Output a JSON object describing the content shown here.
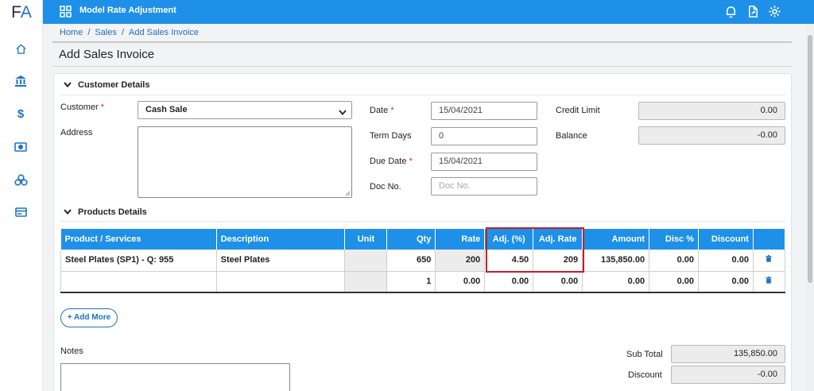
{
  "sidebar": {
    "logo_f": "F",
    "logo_a": "A",
    "items": [
      {
        "icon": "home-icon"
      },
      {
        "icon": "bank-icon"
      },
      {
        "icon": "dollar-icon",
        "glyph": "$"
      },
      {
        "icon": "cash-icon"
      },
      {
        "icon": "coins-icon"
      },
      {
        "icon": "card-icon"
      }
    ]
  },
  "topbar": {
    "title": "Model Rate Adjustment",
    "color": "#1e90e8",
    "icons": [
      "bell-icon",
      "share-icon",
      "gear-icon"
    ]
  },
  "breadcrumb": {
    "items": [
      "Home",
      "Sales",
      "Add Sales Invoice"
    ],
    "separator": "/"
  },
  "page": {
    "title": "Add Sales Invoice"
  },
  "customer_section": {
    "heading": "Customer Details",
    "customer_label": "Customer",
    "customer_value": "Cash Sale",
    "address_label": "Address",
    "date_label": "Date",
    "date_value": "15/04/2021",
    "term_days_label": "Term Days",
    "term_days_value": "0",
    "due_date_label": "Due Date",
    "due_date_value": "15/04/2021",
    "doc_no_label": "Doc No.",
    "doc_no_placeholder": "Doc No.",
    "credit_limit_label": "Credit Limit",
    "credit_limit_value": "0.00",
    "balance_label": "Balance",
    "balance_value": "-0.00",
    "required_mark": "*"
  },
  "products_section": {
    "heading": "Products Details",
    "columns": [
      "Product / Services",
      "Description",
      "Unit",
      "Qty",
      "Rate",
      "Adj. (%)",
      "Adj. Rate",
      "Amount",
      "Disc %",
      "Discount"
    ],
    "rows": [
      {
        "product": "Steel Plates (SP1) - Q: 955",
        "description": "Steel Plates",
        "unit": "",
        "qty": "650",
        "rate": "200",
        "adj_pct": "4.50",
        "adj_rate": "209",
        "amount": "135,850.00",
        "disc_pct": "0.00",
        "discount": "0.00"
      },
      {
        "product": "",
        "description": "",
        "unit": "",
        "qty": "1",
        "rate": "0.00",
        "adj_pct": "0.00",
        "adj_rate": "0.00",
        "amount": "0.00",
        "disc_pct": "0.00",
        "discount": "0.00"
      }
    ],
    "add_more_label": "+ Add More",
    "highlight_color": "#c0202a"
  },
  "footer": {
    "notes_label": "Notes",
    "subtotal_label": "Sub Total",
    "subtotal_value": "135,850.00",
    "discount_label": "Discount",
    "discount_value": "-0.00"
  }
}
